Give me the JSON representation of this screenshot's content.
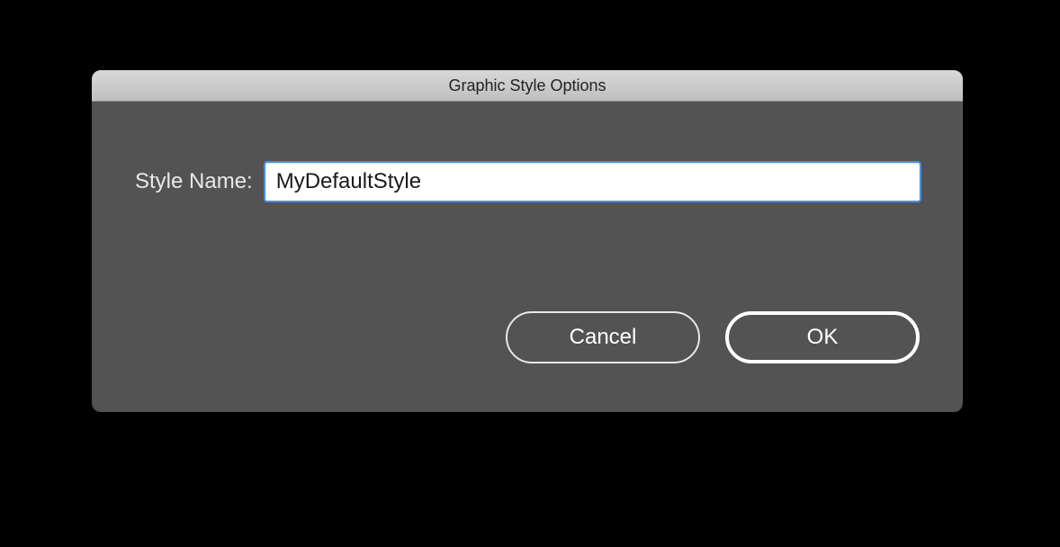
{
  "dialog": {
    "title": "Graphic Style Options",
    "field_label": "Style Name:",
    "field_value": "MyDefaultStyle",
    "buttons": {
      "cancel": "Cancel",
      "ok": "OK"
    }
  }
}
